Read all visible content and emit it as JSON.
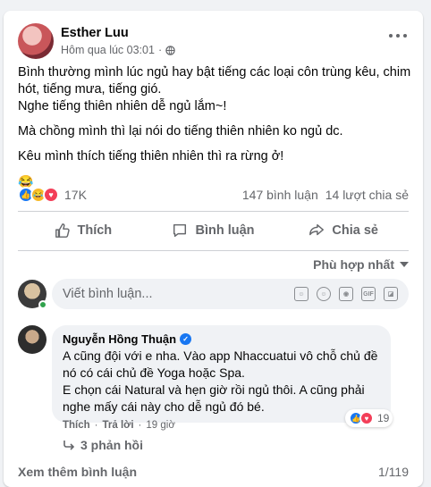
{
  "post": {
    "author": "Esther Luu",
    "time": "Hôm qua lúc 03:01",
    "dot": "·",
    "paragraphs": [
      "Bình thường mình lúc ngủ hay bật tiếng các loại côn trùng kêu, chim hót, tiếng mưa, tiếng gió.",
      "Nghe tiếng thiên nhiên dễ ngủ lắm~!",
      "Mà chồng mình thì lại nói do tiếng thiên nhiên ko ngủ dc.",
      "Kêu mình thích tiếng thiên nhiên thì ra rừng ở!"
    ],
    "emoji": "😂"
  },
  "stats": {
    "reactions": "17K",
    "comments": "147 bình luận",
    "shares": "14 lượt chia sẻ"
  },
  "actions": {
    "like": "Thích",
    "comment": "Bình luận",
    "share": "Chia sẻ"
  },
  "sort": "Phù hợp nhất",
  "composer": {
    "placeholder": "Viết bình luận..."
  },
  "comment": {
    "author": "Nguyễn Hồng Thuận",
    "lines": [
      "A cũng đội với e nha. Vào app Nhaccuatui vô chỗ chủ đề nó có cái chủ đề Yoga hoặc Spa.",
      "E chọn cái Natural và hẹn giờ rồi ngủ thôi. A cũng phải nghe mấy cái này cho dễ ngủ đó bé."
    ],
    "like": "Thích",
    "reply": "Trả lời",
    "sep": "·",
    "age": "19 giờ",
    "reactions": "19",
    "replies": "3 phản hồi"
  },
  "footer": {
    "see_more": "Xem thêm bình luận",
    "page": "1/119"
  },
  "colors": {
    "accent": "#1877f2",
    "muted": "#65676b",
    "online": "#31a24c"
  }
}
